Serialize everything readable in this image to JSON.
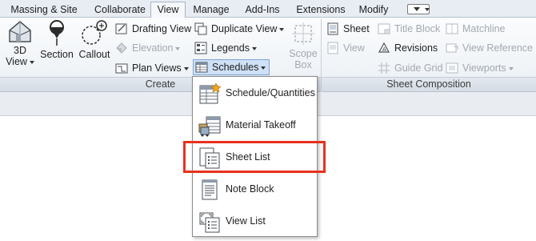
{
  "tabs": [
    {
      "label": "Massing & Site",
      "active": false
    },
    {
      "label": "Collaborate",
      "active": false
    },
    {
      "label": "View",
      "active": true
    },
    {
      "label": "Manage",
      "active": false
    },
    {
      "label": "Add-Ins",
      "active": false
    },
    {
      "label": "Extensions",
      "active": false
    },
    {
      "label": "Modify",
      "active": false
    }
  ],
  "create_panel": {
    "title": "Create",
    "big_buttons": {
      "view3d_line1": "3D",
      "view3d_line2": "View",
      "section": "Section",
      "callout": "Callout",
      "scope_box_line1": "Scope",
      "scope_box_line2": "Box"
    },
    "small": {
      "drafting_view": "Drafting View",
      "elevation": "Elevation",
      "plan_views": "Plan Views",
      "duplicate_view": "Duplicate View",
      "legends": "Legends",
      "schedules": "Schedules"
    }
  },
  "sheet_panel": {
    "title": "Sheet Composition",
    "small": {
      "sheet": "Sheet",
      "view": "View",
      "title_block": "Title Block",
      "revisions": "Revisions",
      "guide_grid": "Guide Grid",
      "matchline": "Matchline",
      "view_reference": "View Reference",
      "viewports": "Viewports"
    }
  },
  "schedules_menu": {
    "items": [
      {
        "label": "Schedule/Quantities",
        "icon": "schedule-quantities-icon"
      },
      {
        "label": "Material Takeoff",
        "icon": "material-takeoff-icon"
      },
      {
        "label": "Sheet List",
        "icon": "sheet-list-icon",
        "highlighted": true
      },
      {
        "label": "Note Block",
        "icon": "note-block-icon"
      },
      {
        "label": "View List",
        "icon": "view-list-icon"
      }
    ]
  },
  "colors": {
    "highlight": "#e8311e",
    "selected_bg": "#cfe1f6",
    "disabled_text": "#a3a9b0"
  }
}
